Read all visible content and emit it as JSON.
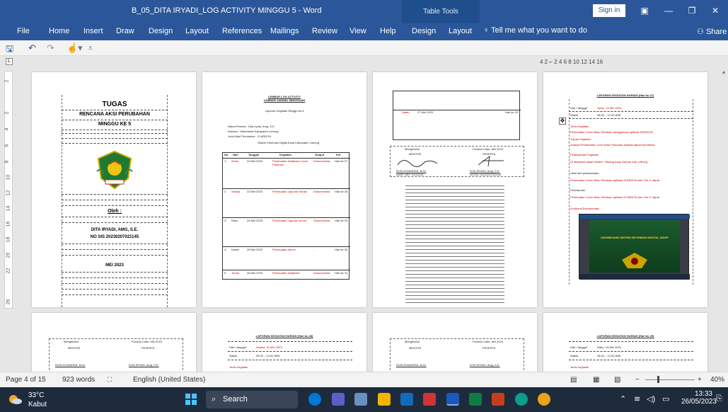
{
  "window": {
    "title": "B_05_DITA IRYADI_LOG ACTIVITY MINGGU 5 - Word",
    "table_tools": "Table Tools",
    "sign_in": "Sign in"
  },
  "ribbon": {
    "tabs": [
      "File",
      "Home",
      "Insert",
      "Draw",
      "Design",
      "Layout",
      "References",
      "Mailings",
      "Review",
      "View",
      "Help",
      "Design",
      "Layout"
    ],
    "tell_me": "Tell me what you want to do",
    "share": "Share"
  },
  "ruler": {
    "numbers": "4   2   ⌐   2    4    6    8    10   12   14   16"
  },
  "vruler_numbers": [
    "2",
    "2",
    "4",
    "6",
    "8",
    "10",
    "12",
    "14",
    "16",
    "18",
    "20",
    "22",
    "26"
  ],
  "page1": {
    "title": "TUGAS",
    "subtitle": "RENCANA AKSI PERUBAHAN",
    "week": "MINGGU KE 5",
    "oleh": "Oleh :",
    "name": "DITA IRYADI, AMG, S.E.",
    "nosis": "NO SIS 20230207021145",
    "date": "MEI     2023"
  },
  "page2": {
    "header1": "LEMBAR LOG ACTIVITY",
    "header2": "LEMBAR JADWAL MINGGUAN",
    "kegiatan": "Laporan Kegiatan Minggu ke-5",
    "rows": [
      "Nama Peserta   : Dita Iryadi, Amg, S.E.",
      "Instansi          : Sekretariat Kabupaten Lebong",
      "Judul Aksi Perubahan : SI ARDITA",
      "Sistem Informasi Digital Arsip Kabupaten Lebong"
    ],
    "table_header": [
      "No",
      "Hari",
      "Tanggal",
      "Kegiatan",
      "Output",
      "Ket"
    ],
    "table_rows": [
      [
        "1",
        "Senin",
        "22 Mei 2023",
        "Pembuatan Database Cover Panduan",
        "Dokumentasi",
        "Hari ke 27"
      ],
      [
        "2",
        "Selasa",
        "23 Mei 2023",
        "Pembuatan Laporan Harian",
        "Dokumentasi",
        "Hari ke 28"
      ],
      [
        "3",
        "Rabu",
        "24 Mei 2023",
        "Pembuatan Laporan server",
        "Dokumentasi",
        "Hari ke 29"
      ],
      [
        "4",
        "Kamis",
        "25 Mei 2023",
        "Pembuatan Admin",
        "-",
        "Hari ke 30"
      ],
      [
        "5",
        "Jumat",
        "26 Mei 2023",
        "Pembuatan Database",
        "Dokumentasi",
        "Hari ke 31"
      ]
    ]
  },
  "page3": {
    "row_day": "Sabtu",
    "row_date": "27 Mei 2023",
    "row_ket": "Hari ke 32",
    "mengetahui": "Mengetahui",
    "place_date": "Pondok Cabe,      Mei 2023",
    "mentor_label": "MENTOR",
    "peserta_label": "PESERTA",
    "mentor_name": "RUSLICHANDRA, M.M.",
    "mentor_nip": "AKBP NRP 70120181",
    "peserta_name": "DITA IRYADI, Amg, S.E.",
    "peserta_nosis": "NOSIS 20230207021145"
  },
  "page4": {
    "header": "LAPORAN KEGIATAN HARIAN (Hari ke-27)",
    "tanggal_label": "Hari / tanggal",
    "tanggal_value": "Senin, 22 Mei 2023",
    "waktu_label": "Waktu",
    "waktu_value": "08.00 – 12.00 WIB",
    "lines": [
      "Jenis Kegiatan",
      "Pembuatan Cover Buku Panduan penggunaan aplikasi SIARDITA",
      "Tujuan Kegiatan",
      "Adanya Pembuatan Cover Buku Panduan aplikasi dapat membantu",
      "Pelaksanaan Kegiatan",
      "Di aksesibel dalam sistem / Bidang Arsip Daerah Kab Lebong",
      "Hasil dari pelaksanaan",
      "Pembuatan Cover Buku Panduan aplikasi SI ARDITA oleh Tim IT dapat",
      "Kesimpulan",
      "Pembuatan Cover Buku Panduan aplikasi SI ARDITA oleh Tim IT dapat",
      "Evidence/Dokumentasi"
    ],
    "screenshot_title": "DASHBOARD SISTEM INFORMASI DIGITAL ARSIP"
  },
  "bottom_pages": {
    "p2_header": "LAPORAN KEGIATAN HARIAN (Hari ke-28)",
    "p2_date": "Selasa, 23 Mei 2023",
    "p2_time": "08.00 – 14.00 WIB",
    "p4_header": "LAPORAN KEGIATAN HARIAN (Hari ke-29)",
    "p4_date": "Rabu, 24 Mei 2023",
    "p4_time": "08.00 – 12.00 WIB",
    "jenis": "Jenis Kegiatan"
  },
  "status": {
    "page": "Page 4 of 15",
    "words": "923 words",
    "language": "English (United States)",
    "zoom": "40%"
  },
  "taskbar": {
    "temperature": "33°C",
    "weather": "Kabut",
    "search": "Search",
    "time": "13:33",
    "date": "26/05/2023"
  },
  "colors": {
    "word_blue": "#2b579a",
    "taskbar": "#1e2b3c"
  }
}
